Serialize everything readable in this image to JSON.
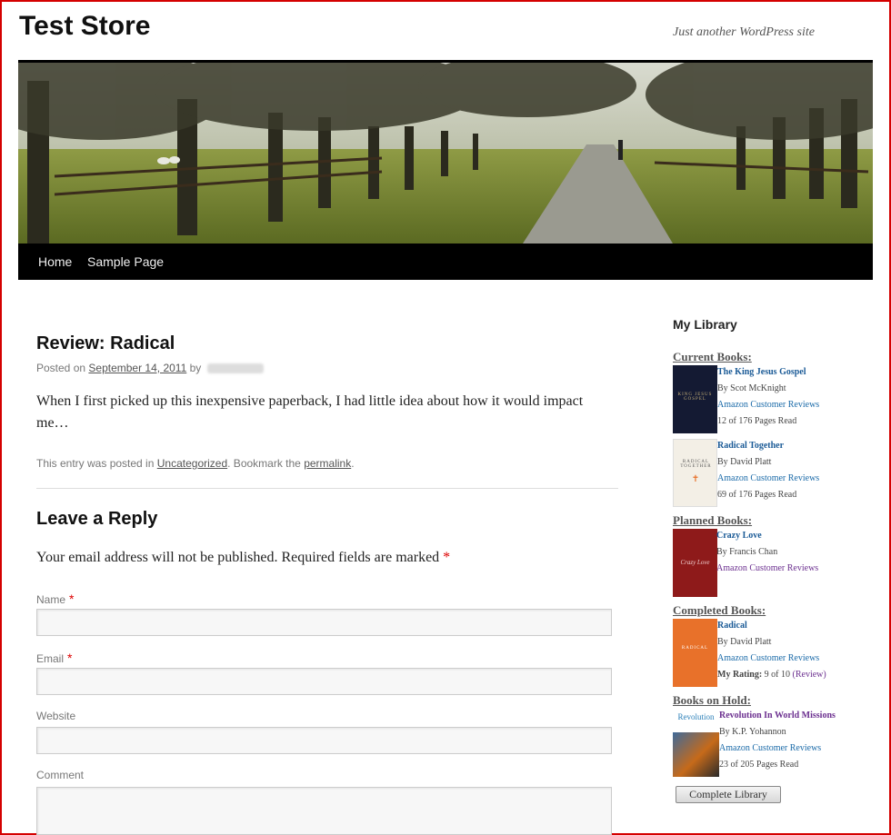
{
  "site": {
    "title": "Test Store",
    "tagline": "Just another WordPress site"
  },
  "nav": [
    {
      "label": "Home"
    },
    {
      "label": "Sample Page"
    }
  ],
  "post": {
    "title": "Review: Radical",
    "posted_on": "Posted on",
    "date": "September 14, 2011",
    "by": "by",
    "excerpt": "When I first picked up this inexpensive paperback, I had little idea about how it would impact me…",
    "footer_pre": "This entry was posted in",
    "category": "Uncategorized",
    "footer_mid": ". Bookmark the",
    "permalink": "permalink",
    "footer_end": "."
  },
  "reply": {
    "title": "Leave a Reply",
    "notes": "Your email address will not be published. Required fields are marked",
    "required_mark": "*",
    "fields": {
      "name": "Name",
      "email": "Email",
      "website": "Website",
      "comment": "Comment"
    }
  },
  "library": {
    "title": "My Library",
    "button": "Complete Library",
    "shelves": [
      {
        "heading": "Current Books:",
        "books": [
          {
            "title": "The King Jesus Gospel",
            "author": "By Scot McKnight",
            "reviews": "Amazon Customer Reviews",
            "progress": "12 of 176 Pages Read",
            "cover_text": "KING JESUS GOSPEL",
            "cover_color": "#141a33"
          },
          {
            "title": "Radical Together",
            "author": "By David Platt",
            "reviews": "Amazon Customer Reviews",
            "progress": "69 of 176 Pages Read",
            "cover_text": "RADICAL TOGETHER",
            "cover_color": "#f3efe6"
          }
        ]
      },
      {
        "heading": "Planned Books:",
        "books": [
          {
            "title": "Crazy Love",
            "author": "By Francis Chan",
            "reviews": "Amazon Customer Reviews",
            "cover_text": "Crazy Love",
            "cover_color": "#8e1a1a"
          }
        ]
      },
      {
        "heading": "Completed Books:",
        "books": [
          {
            "title": "Radical",
            "author": "By David Platt",
            "reviews": "Amazon Customer Reviews",
            "rating_label": "My Rating:",
            "rating_value": "9 of 10",
            "rating_link": "(Review)",
            "cover_text": "RADICAL",
            "cover_color": "#e8712a"
          }
        ]
      },
      {
        "heading": "Books on Hold:",
        "books": [
          {
            "title": "Revolution In World Missions",
            "author": "By K.P. Yohannon",
            "reviews": "Amazon Customer Reviews",
            "progress": "23 of 205 Pages Read",
            "cover_text": "Revolution",
            "cover_color": "#ffffff"
          }
        ]
      }
    ]
  },
  "colors": {
    "frame": "#d40000",
    "nav_bg": "#000000",
    "required": "#dd0000",
    "link": "#1a6aa8",
    "visited_link": "#6b2f8f"
  }
}
